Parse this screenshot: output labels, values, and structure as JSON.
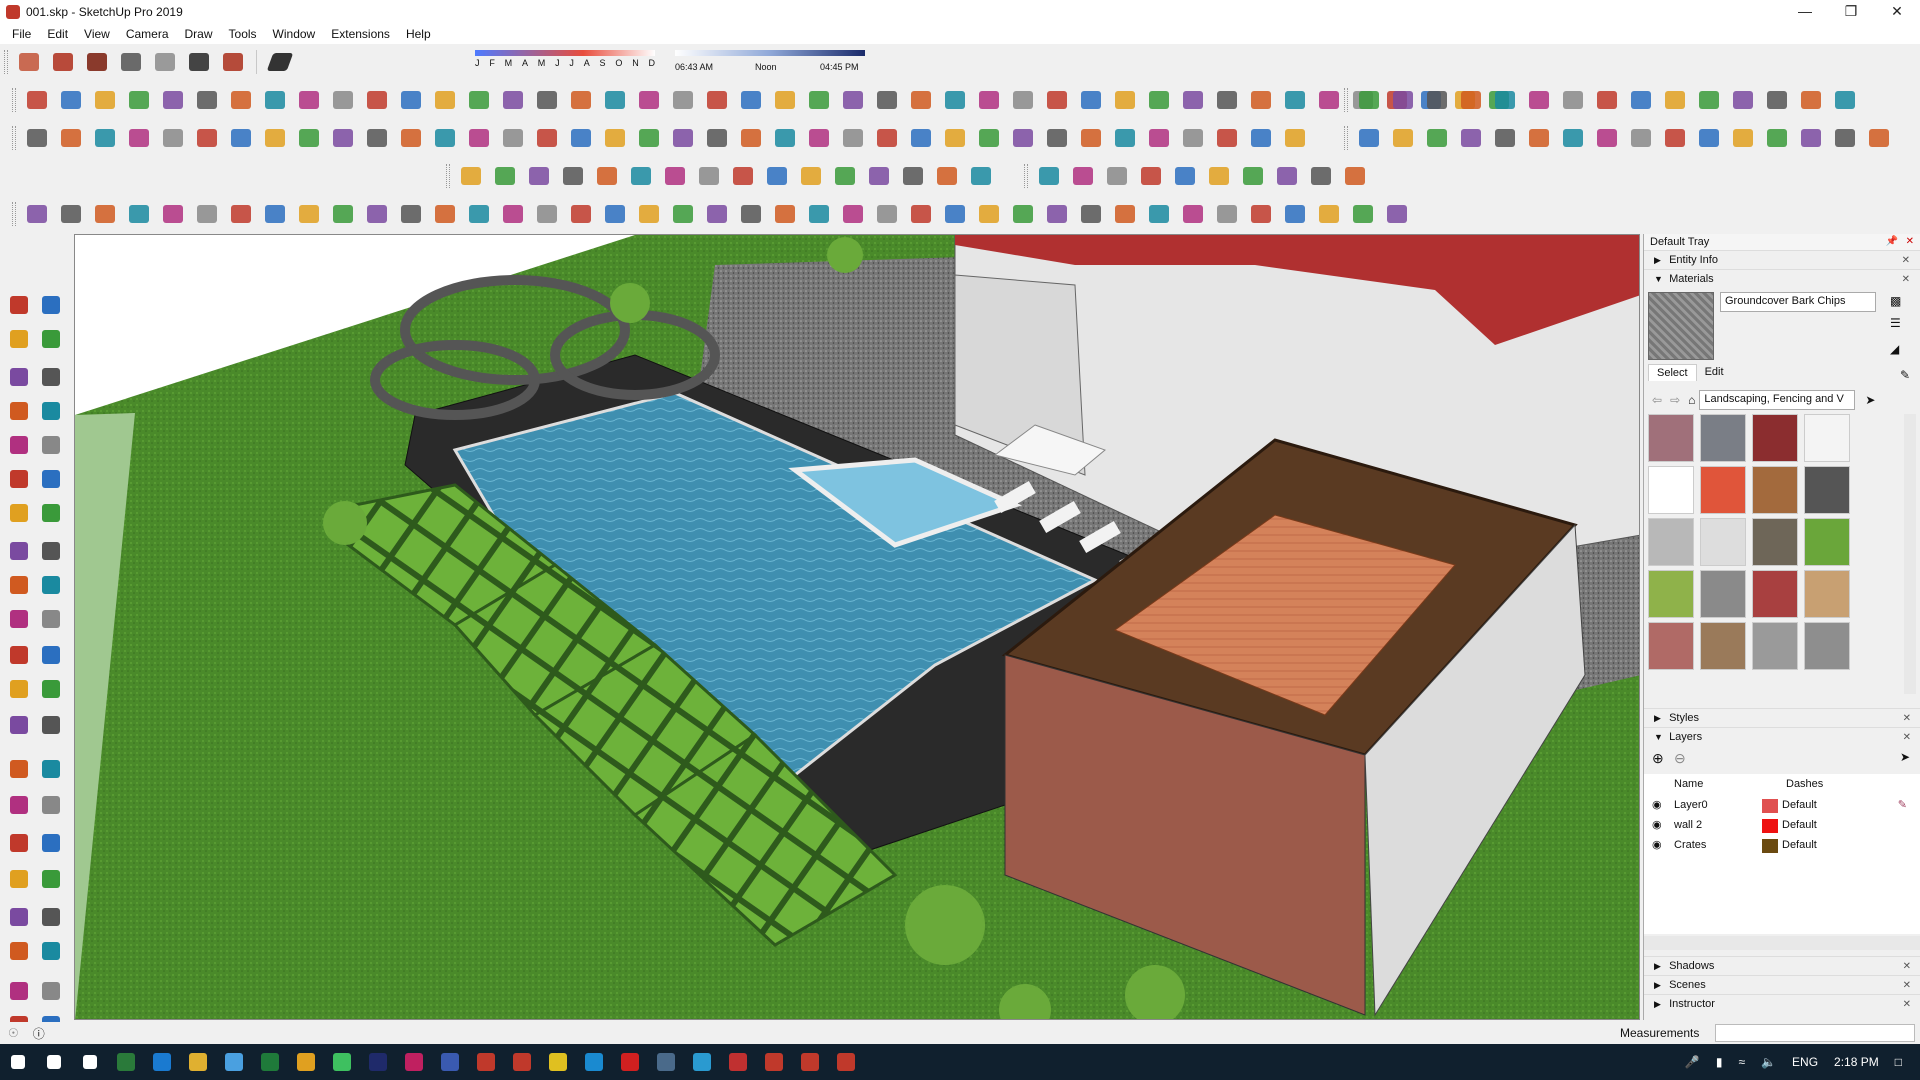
{
  "window": {
    "title": "001.skp - SketchUp Pro 2019",
    "controls": [
      "minimize-icon",
      "maximize-icon",
      "close-icon"
    ]
  },
  "menu": [
    "File",
    "Edit",
    "View",
    "Camera",
    "Draw",
    "Tools",
    "Window",
    "Extensions",
    "Help"
  ],
  "shadow_settings": {
    "months": [
      "J",
      "F",
      "M",
      "A",
      "M",
      "J",
      "J",
      "A",
      "S",
      "O",
      "N",
      "D"
    ],
    "time_start": "06:43 AM",
    "time_mid": "Noon",
    "time_end": "04:45 PM"
  },
  "toolbars": {
    "row1_left": [
      "views-iso-icon",
      "views-top-icon",
      "views-front-icon",
      "views-right-icon",
      "views-back-icon",
      "views-left-icon",
      "views-bottom-icon"
    ],
    "row1_shadow_toggle": "shadow-toggle-icon",
    "row2_count": 44,
    "row2_right_count": 15,
    "row3_count": 38,
    "row3_right_count": 16,
    "row4_count": 16,
    "row4_right_count": 10,
    "row5_count": 41
  },
  "tray": {
    "title": "Default Tray",
    "panels": {
      "entity_info": "Entity Info",
      "materials": "Materials",
      "styles": "Styles",
      "layers": "Layers",
      "shadows": "Shadows",
      "scenes": "Scenes",
      "instructor": "Instructor"
    },
    "materials": {
      "current_material": "Groundcover Bark Chips",
      "tab_select": "Select",
      "tab_edit": "Edit",
      "collection": "Landscaping, Fencing and V",
      "swatch_colors": [
        "#a0707a",
        "#7a7e86",
        "#8b2d2f",
        "#f4f4f4",
        "#ffffff",
        "#e0553a",
        "#a36a3d",
        "#555555",
        "#b8b8b8",
        "#dddddd",
        "#6e6658",
        "#6aa63a",
        "#8fb24a",
        "#8a8a8a",
        "#a84040",
        "#c8a072",
        "#b06a66",
        "#9a7a5a",
        "#9a9a9a",
        "#8e8e8e"
      ]
    },
    "layers": {
      "col_name": "Name",
      "col_dashes": "Dashes",
      "rows": [
        {
          "name": "Layer0",
          "color": "#e05050",
          "dashes": "Default"
        },
        {
          "name": "wall 2",
          "color": "#ee1111",
          "dashes": "Default"
        },
        {
          "name": "Crates",
          "color": "#6b4a10",
          "dashes": "Default"
        }
      ]
    }
  },
  "status": {
    "measurements_label": "Measurements",
    "measurements_value": ""
  },
  "taskbar": {
    "language": "ENG",
    "time": "2:18 PM"
  }
}
